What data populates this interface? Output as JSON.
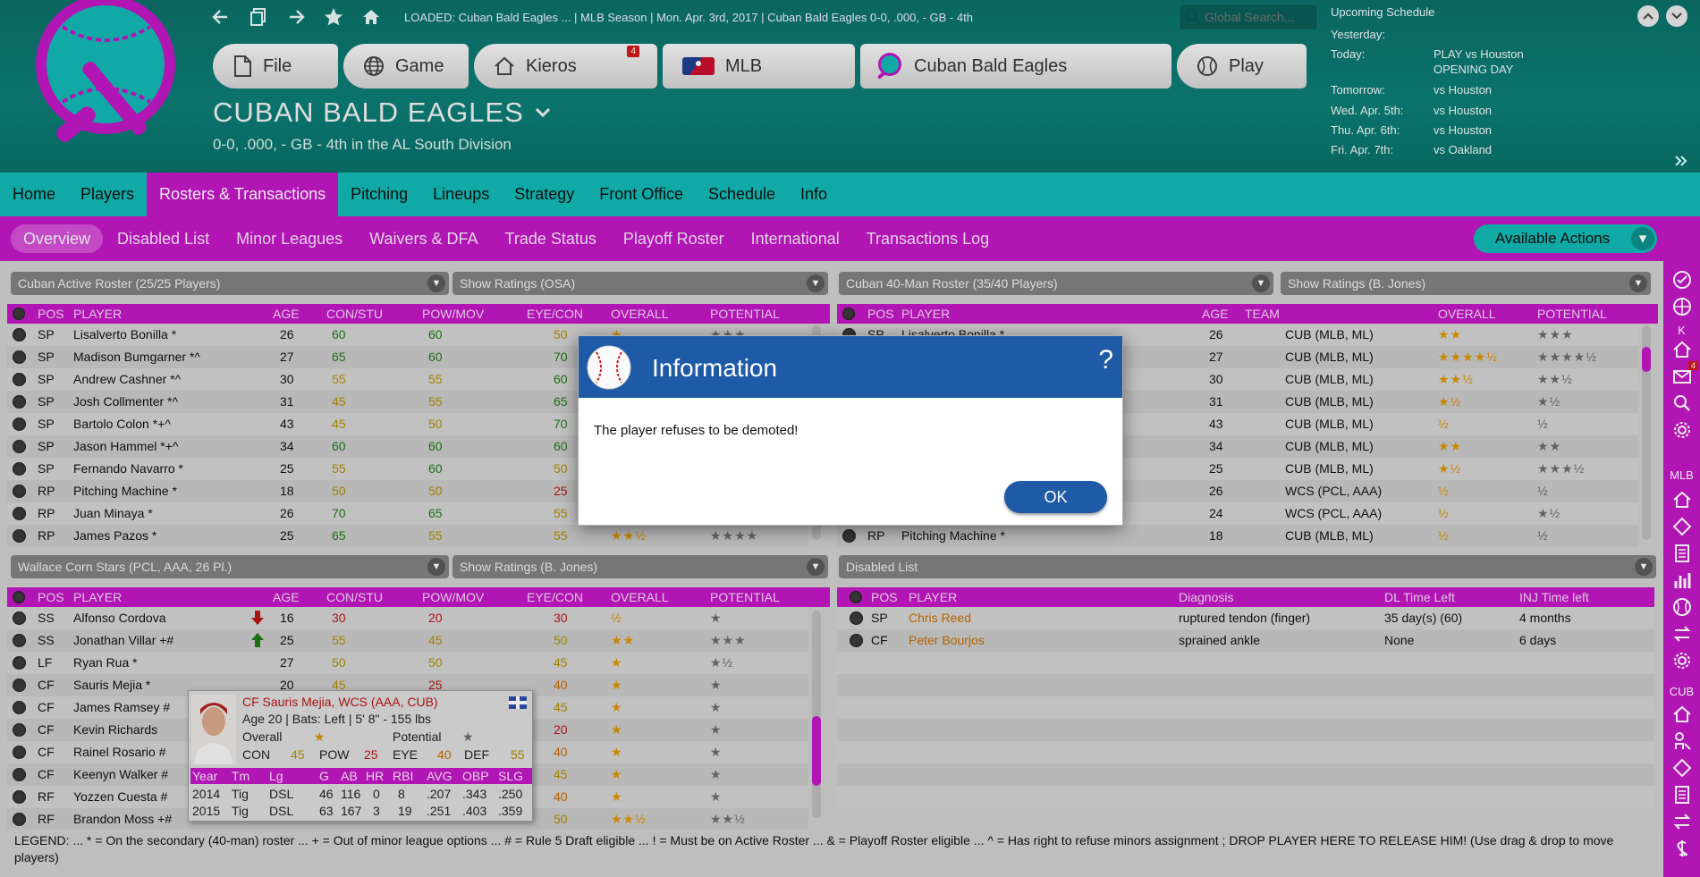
{
  "header": {
    "loaded_text": "LOADED: Cuban Bald Eagles ...  |  MLB Season  |  Mon. Apr. 3rd, 2017  |  Cuban Bald Eagles  0-0, .000, - GB - 4th",
    "search_placeholder": "Global Search...",
    "nav": {
      "file": "File",
      "game": "Game",
      "kieros": "Kieros",
      "kieros_badge": "4",
      "mlb": "MLB",
      "team": "Cuban Bald Eagles",
      "play": "Play"
    },
    "team_name": "CUBAN BALD EAGLES",
    "team_record": "0-0, .000, - GB - 4th in the AL South Division"
  },
  "schedule": {
    "title": "Upcoming Schedule",
    "rows": [
      {
        "label": "Yesterday:",
        "value": ""
      },
      {
        "label": "Today:",
        "value": "PLAY vs Houston",
        "value2": "OPENING DAY"
      },
      {
        "label": "Tomorrow:",
        "value": "vs Houston"
      },
      {
        "label": "Wed. Apr. 5th:",
        "value": "vs Houston"
      },
      {
        "label": "Thu. Apr. 6th:",
        "value": "vs Houston"
      },
      {
        "label": "Fri. Apr. 7th:",
        "value": "vs Oakland"
      }
    ]
  },
  "main_menu": [
    "Home",
    "Players",
    "Rosters & Transactions",
    "Pitching",
    "Lineups",
    "Strategy",
    "Front Office",
    "Schedule",
    "Info"
  ],
  "sub_menu": [
    "Overview",
    "Disabled List",
    "Minor Leagues",
    "Waivers & DFA",
    "Trade Status",
    "Playoff Roster",
    "International",
    "Transactions Log"
  ],
  "available_actions": "Available Actions",
  "right_sidebar": {
    "k_label": "K",
    "k_badge": "4",
    "mlb_label": "MLB",
    "cub_label": "CUB"
  },
  "active_roster": {
    "dropdown": "Cuban Active Roster (25/25 Players)",
    "ratings": "Show Ratings (OSA)",
    "headers": [
      "POS",
      "PLAYER",
      "AGE",
      "CON/STU",
      "POW/MOV",
      "EYE/CON",
      "OVERALL",
      "POTENTIAL"
    ],
    "rows": [
      {
        "pos": "SP",
        "player": "Lisalverto Bonilla *",
        "age": "26",
        "c1": "60",
        "c2": "60",
        "c3": "50",
        "ov": "★",
        "pot": "★★★"
      },
      {
        "pos": "SP",
        "player": "Madison Bumgarner *^",
        "age": "27",
        "c1": "65",
        "c2": "60",
        "c3": "70",
        "ov": "",
        "pot": ""
      },
      {
        "pos": "SP",
        "player": "Andrew Cashner *^",
        "age": "30",
        "c1": "55",
        "c2": "55",
        "c3": "60",
        "ov": "",
        "pot": ""
      },
      {
        "pos": "SP",
        "player": "Josh Collmenter *^",
        "age": "31",
        "c1": "45",
        "c2": "55",
        "c3": "65",
        "ov": "",
        "pot": ""
      },
      {
        "pos": "SP",
        "player": "Bartolo Colon *+^",
        "age": "43",
        "c1": "45",
        "c2": "50",
        "c3": "70",
        "ov": "",
        "pot": ""
      },
      {
        "pos": "SP",
        "player": "Jason Hammel *+^",
        "age": "34",
        "c1": "60",
        "c2": "60",
        "c3": "60",
        "ov": "",
        "pot": ""
      },
      {
        "pos": "SP",
        "player": "Fernando Navarro *",
        "age": "25",
        "c1": "55",
        "c2": "60",
        "c3": "50",
        "ov": "",
        "pot": ""
      },
      {
        "pos": "RP",
        "player": "Pitching Machine *",
        "age": "18",
        "c1": "50",
        "c2": "50",
        "c3": "25",
        "ov": "",
        "pot": ""
      },
      {
        "pos": "RP",
        "player": "Juan Minaya *",
        "age": "26",
        "c1": "70",
        "c2": "65",
        "c3": "55",
        "ov": "",
        "pot": ""
      },
      {
        "pos": "RP",
        "player": "James Pazos *",
        "age": "25",
        "c1": "65",
        "c2": "55",
        "c3": "55",
        "ov": "★★½",
        "pot": "★★★★"
      }
    ]
  },
  "forty_man": {
    "dropdown": "Cuban 40-Man Roster (35/40 Players)",
    "ratings": "Show Ratings (B. Jones)",
    "headers": [
      "POS",
      "PLAYER",
      "AGE",
      "TEAM",
      "OVERALL",
      "POTENTIAL"
    ],
    "rows": [
      {
        "pos": "SP",
        "player": "Lisalverto Bonilla *",
        "age": "26",
        "team": "CUB (MLB, ML)",
        "ov": "★★",
        "pot": "★★★"
      },
      {
        "pos": "",
        "player": "",
        "age": "27",
        "team": "CUB (MLB, ML)",
        "ov": "★★★★½",
        "pot": "★★★★½"
      },
      {
        "pos": "",
        "player": "",
        "age": "30",
        "team": "CUB (MLB, ML)",
        "ov": "★★½",
        "pot": "★★½"
      },
      {
        "pos": "",
        "player": "",
        "age": "31",
        "team": "CUB (MLB, ML)",
        "ov": "★½",
        "pot": "★½"
      },
      {
        "pos": "",
        "player": "",
        "age": "43",
        "team": "CUB (MLB, ML)",
        "ov": "½",
        "pot": "½"
      },
      {
        "pos": "",
        "player": "",
        "age": "34",
        "team": "CUB (MLB, ML)",
        "ov": "★★",
        "pot": "★★"
      },
      {
        "pos": "",
        "player": "",
        "age": "25",
        "team": "CUB (MLB, ML)",
        "ov": "★½",
        "pot": "★★★½"
      },
      {
        "pos": "",
        "player": "",
        "age": "26",
        "team": "WCS (PCL, AAA)",
        "ov": "½",
        "pot": "½"
      },
      {
        "pos": "",
        "player": "",
        "age": "24",
        "team": "WCS (PCL, AAA)",
        "ov": "½",
        "pot": "★½"
      },
      {
        "pos": "RP",
        "player": "Pitching Machine *",
        "age": "18",
        "team": "CUB (MLB, ML)",
        "ov": "½",
        "pot": "½"
      }
    ]
  },
  "minors": {
    "dropdown": "Wallace Corn Stars (PCL, AAA, 26 Pl.)",
    "ratings": "Show Ratings (B. Jones)",
    "headers": [
      "POS",
      "PLAYER",
      "AGE",
      "CON/STU",
      "POW/MOV",
      "EYE/CON",
      "OVERALL",
      "POTENTIAL"
    ],
    "rows": [
      {
        "pos": "SS",
        "player": "Alfonso Cordova",
        "arrow": "down",
        "age": "16",
        "c1": "30",
        "c2": "20",
        "c3": "30",
        "ov": "½",
        "pot": "★"
      },
      {
        "pos": "SS",
        "player": "Jonathan Villar +#",
        "arrow": "up",
        "age": "25",
        "c1": "55",
        "c2": "45",
        "c3": "50",
        "ov": "★★",
        "pot": "★★★"
      },
      {
        "pos": "LF",
        "player": "Ryan Rua *",
        "arrow": "",
        "age": "27",
        "c1": "50",
        "c2": "50",
        "c3": "45",
        "ov": "★",
        "pot": "★½"
      },
      {
        "pos": "CF",
        "player": "Sauris Mejia *",
        "arrow": "",
        "age": "20",
        "c1": "45",
        "c2": "25",
        "c3": "40",
        "ov": "★",
        "pot": "★"
      },
      {
        "pos": "CF",
        "player": "James Ramsey #",
        "arrow": "",
        "age": "",
        "c1": "",
        "c2": "",
        "c3": "45",
        "ov": "★",
        "pot": "★"
      },
      {
        "pos": "CF",
        "player": "Kevin Richards",
        "arrow": "",
        "age": "",
        "c1": "",
        "c2": "",
        "c3": "20",
        "ov": "★",
        "pot": "★"
      },
      {
        "pos": "CF",
        "player": "Rainel Rosario #",
        "arrow": "",
        "age": "",
        "c1": "",
        "c2": "",
        "c3": "40",
        "ov": "★",
        "pot": "★"
      },
      {
        "pos": "CF",
        "player": "Keenyn Walker #",
        "arrow": "",
        "age": "",
        "c1": "",
        "c2": "",
        "c3": "45",
        "ov": "★",
        "pot": "★"
      },
      {
        "pos": "RF",
        "player": "Yozzen Cuesta #",
        "arrow": "",
        "age": "",
        "c1": "",
        "c2": "",
        "c3": "40",
        "ov": "★",
        "pot": "★"
      },
      {
        "pos": "RF",
        "player": "Brandon Moss +#",
        "arrow": "",
        "age": "",
        "c1": "",
        "c2": "",
        "c3": "50",
        "ov": "★★½",
        "pot": "★★½"
      }
    ]
  },
  "disabled": {
    "dropdown": "Disabled List",
    "headers": [
      "POS",
      "PLAYER",
      "Diagnosis",
      "DL Time Left",
      "INJ Time left"
    ],
    "rows": [
      {
        "pos": "SP",
        "player": "Chris Reed",
        "diag": "ruptured tendon (finger)",
        "dl": "35 day(s) (60)",
        "inj": "4 months"
      },
      {
        "pos": "CF",
        "player": "Peter Bourjos",
        "diag": "sprained ankle",
        "dl": "None",
        "inj": "6 days"
      }
    ]
  },
  "tooltip": {
    "title": "CF Sauris Mejia, WCS (AAA, CUB)",
    "bio": "Age 20 | Bats: Left | 5' 8\" - 155 lbs",
    "overall_label": "Overall",
    "potential_label": "Potential",
    "overall_stars": "★",
    "potential_stars": "★",
    "con_label": "CON",
    "con": "45",
    "pow_label": "POW",
    "pow": "25",
    "eye_label": "EYE",
    "eye": "40",
    "def_label": "DEF",
    "def": "55",
    "stat_headers": [
      "Year",
      "Tm",
      "Lg",
      "G",
      "AB",
      "HR",
      "RBI",
      "AVG",
      "OBP",
      "SLG"
    ],
    "stats": [
      [
        "2014",
        "Tig",
        "DSL",
        "46",
        "116",
        "0",
        "8",
        ".207",
        ".343",
        ".250"
      ],
      [
        "2015",
        "Tig",
        "DSL",
        "63",
        "167",
        "3",
        "19",
        ".251",
        ".403",
        ".359"
      ]
    ]
  },
  "legend_text": "LEGEND:  ... * = On the secondary (40-man) roster   ... + = Out of minor league options   ... # = Rule 5 Draft eligible   ... ! = Must be on Active Roster   ... & = Playoff Roster eligible   ... ^ = Has right to refuse minors assignment  ; DROP PLAYER HERE TO RELEASE HIM! (Use drag & drop to move players)",
  "dialog": {
    "title": "Information",
    "help": "?",
    "message": "The player refuses to be demoted!",
    "ok": "OK"
  },
  "colors": {
    "teal": "#0d7d76",
    "menu_teal": "#13b8b3",
    "magenta": "#c017c4",
    "dialog_blue": "#1f5aa6"
  }
}
